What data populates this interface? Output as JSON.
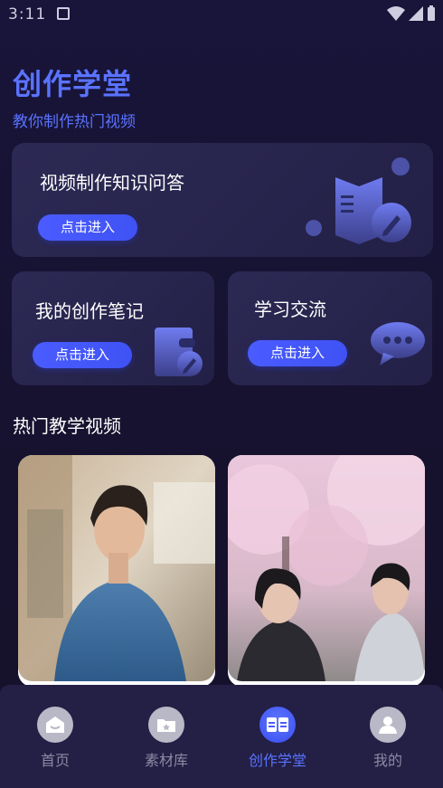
{
  "status_bar": {
    "time": "3:11"
  },
  "header": {
    "title": "创作学堂",
    "subtitle": "教你制作热门视频"
  },
  "cards": {
    "qa": {
      "title": "视频制作知识问答",
      "button": "点击进入",
      "icon": "book-pencil-icon"
    },
    "notes": {
      "title": "我的创作笔记",
      "button": "点击进入",
      "icon": "notebook-pencil-icon"
    },
    "exchange": {
      "title": "学习交流",
      "button": "点击进入",
      "icon": "chat-bubble-icon"
    }
  },
  "section": {
    "title": "热门教学视频"
  },
  "videos": [
    {
      "name": "video-thumbnail-1"
    },
    {
      "name": "video-thumbnail-2"
    }
  ],
  "nav": {
    "items": [
      {
        "label": "首页",
        "icon": "home-icon",
        "active": false
      },
      {
        "label": "素材库",
        "icon": "folder-star-icon",
        "active": false
      },
      {
        "label": "创作学堂",
        "icon": "open-book-icon",
        "active": true
      },
      {
        "label": "我的",
        "icon": "user-icon",
        "active": false
      }
    ]
  },
  "colors": {
    "accent": "#5a73ff",
    "background": "#16122e",
    "card": "#2a2750",
    "button": "#4a5cff"
  }
}
